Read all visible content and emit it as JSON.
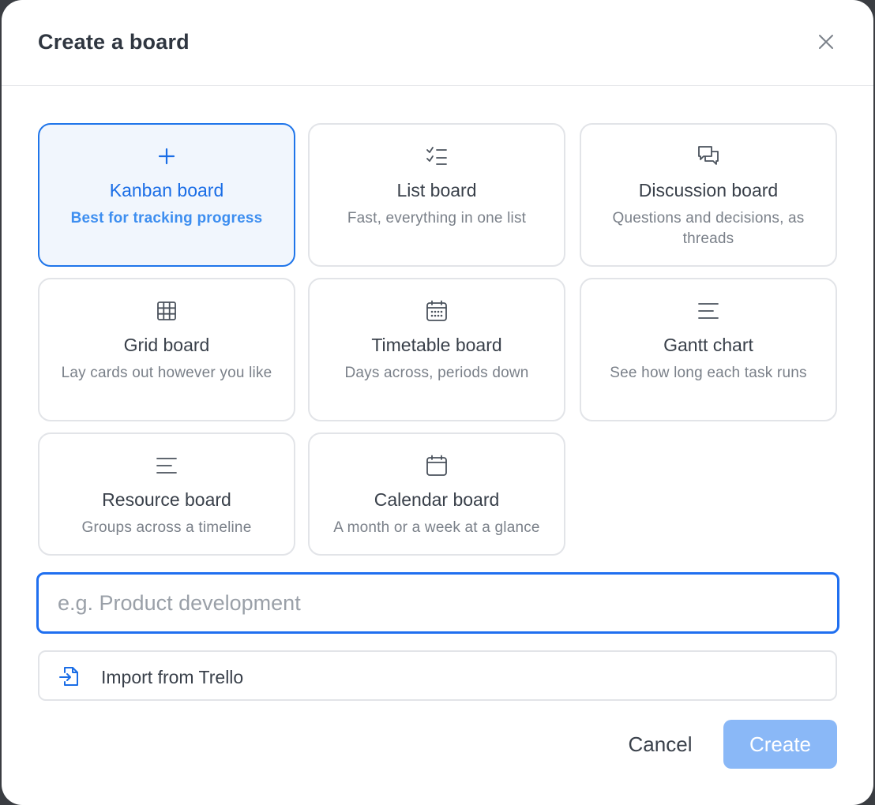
{
  "dialog": {
    "title": "Create a board",
    "close_icon": "close-icon"
  },
  "boards": [
    {
      "name": "Kanban board",
      "description": "Best for tracking progress",
      "icon": "plus-icon",
      "selected": true
    },
    {
      "name": "List board",
      "description": "Fast, everything in one list",
      "icon": "checklist-icon",
      "selected": false
    },
    {
      "name": "Discussion board",
      "description": "Questions and decisions, as threads",
      "icon": "chat-bubbles-icon",
      "selected": false
    },
    {
      "name": "Grid board",
      "description": "Lay cards out however you like",
      "icon": "grid-icon",
      "selected": false
    },
    {
      "name": "Timetable board",
      "description": "Days across, periods down",
      "icon": "calendar-grid-icon",
      "selected": false
    },
    {
      "name": "Gantt chart",
      "description": "See how long each task runs",
      "icon": "lines-icon",
      "selected": false
    },
    {
      "name": "Resource board",
      "description": "Groups across a timeline",
      "icon": "lines-icon",
      "selected": false
    },
    {
      "name": "Calendar board",
      "description": "A month or a week at a glance",
      "icon": "calendar-icon",
      "selected": false
    }
  ],
  "name_input": {
    "value": "",
    "placeholder": "e.g. Product development"
  },
  "import": {
    "label": "Import from Trello",
    "icon": "file-import-icon"
  },
  "actions": {
    "cancel_label": "Cancel",
    "create_label": "Create"
  },
  "colors": {
    "accent": "#1f75ea",
    "create_button_disabled": "#8ab8f7",
    "selected_card_bg": "#f1f6fd"
  }
}
